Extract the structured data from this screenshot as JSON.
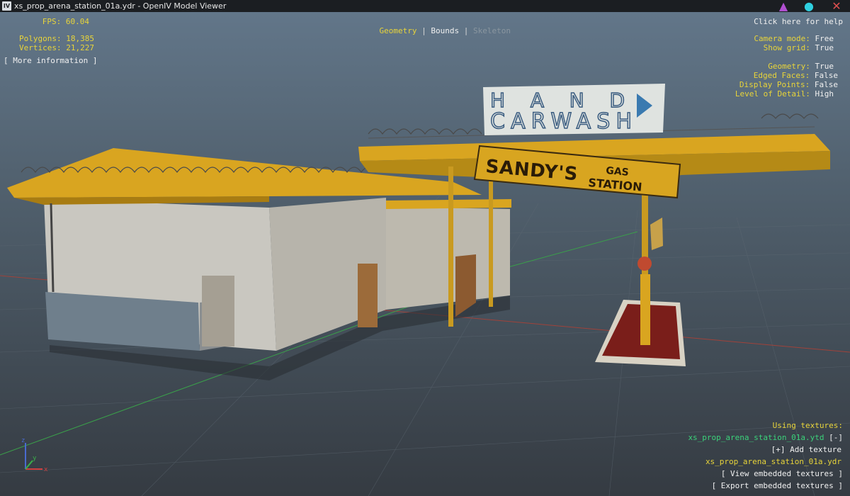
{
  "window": {
    "icon_label": "IV",
    "title": "xs_prop_arena_station_01a.ydr - OpenIV Model Viewer",
    "accent_colors": {
      "minimize": "#b04fd0",
      "maximize": "#2fd0e0",
      "close": "#e05050"
    }
  },
  "stats": {
    "fps_label": "FPS:",
    "fps_value": "60.04",
    "polygons_label": "Polygons:",
    "polygons_value": "18,385",
    "vertices_label": "Vertices:",
    "vertices_value": "21,227",
    "more_info": "[ More information ]"
  },
  "tabs": [
    {
      "label": "Geometry",
      "state": "active"
    },
    {
      "label": "Bounds",
      "state": "normal"
    },
    {
      "label": "Skeleton",
      "state": "disabled"
    }
  ],
  "help": "Click here for help",
  "settings": [
    {
      "label": "Camera mode:",
      "value": "Free"
    },
    {
      "label": "Show grid:",
      "value": "True"
    },
    {
      "label": "Geometry:",
      "value": "True"
    },
    {
      "label": "Edged Faces:",
      "value": "False"
    },
    {
      "label": "Display Points:",
      "value": "False"
    },
    {
      "label": "Level of Detail:",
      "value": "High"
    }
  ],
  "textures": {
    "heading": "Using textures:",
    "ytd_file": "xs_prop_arena_station_01a.ytd",
    "ytd_remove": "[-]",
    "add_texture": "[+] Add texture",
    "ydr_file": "xs_prop_arena_station_01a.ydr",
    "view_embedded": "[ View embedded textures ]",
    "export_embedded": "[ Export embedded textures ]"
  },
  "scene": {
    "sign_hand": "HAND",
    "sign_carwash": "CARWASH",
    "sign_sandys": "SANDY'S",
    "sign_gas": "GAS",
    "sign_station": "STATION"
  },
  "colors": {
    "label_yellow": "#e8d43a",
    "value_white": "#f0f0f0",
    "file_green": "#3ad27a",
    "roof_yellow": "#d9a520"
  }
}
